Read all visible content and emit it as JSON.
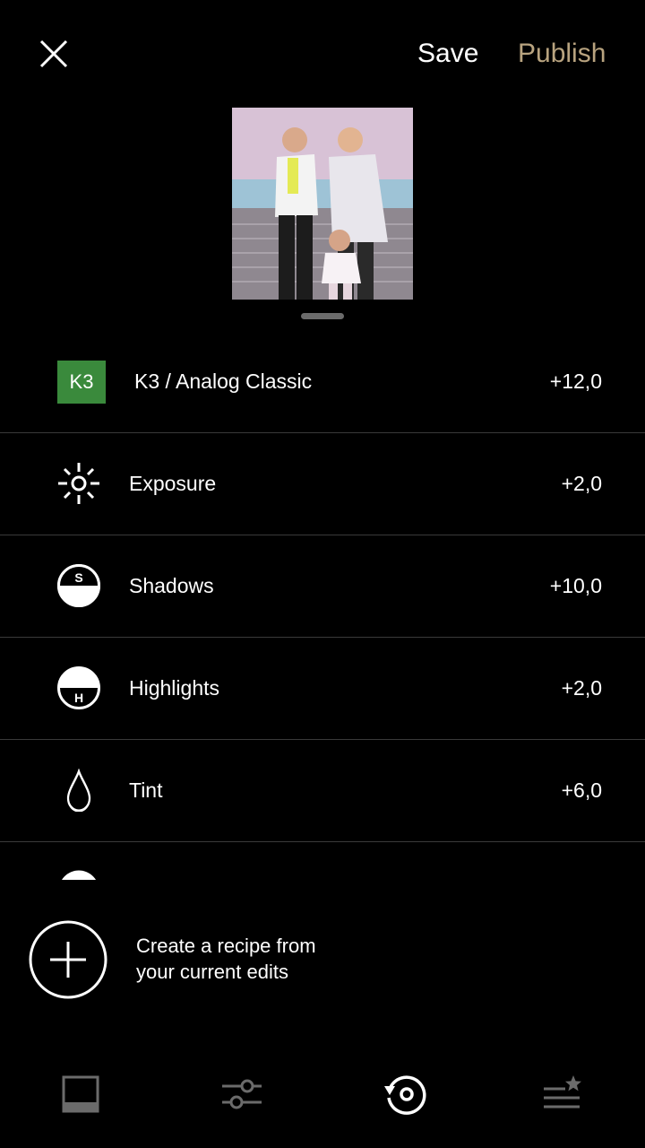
{
  "header": {
    "save_label": "Save",
    "publish_label": "Publish"
  },
  "colors": {
    "accent": "#b8a37f",
    "preset_badge": "#3a8a3c",
    "divider": "#3a3a3a",
    "inactive_icon": "#6b6b6b"
  },
  "preview": {
    "icon": "photo-thumbnail"
  },
  "edits": [
    {
      "icon": "preset-badge",
      "badge": "K3",
      "label": "K3 / Analog Classic",
      "value": "+12,0"
    },
    {
      "icon": "exposure-icon",
      "label": "Exposure",
      "value": "+2,0"
    },
    {
      "icon": "shadows-icon",
      "badge": "S",
      "label": "Shadows",
      "value": "+10,0"
    },
    {
      "icon": "highlights-icon",
      "badge": "H",
      "label": "Highlights",
      "value": "+2,0"
    },
    {
      "icon": "tint-icon",
      "label": "Tint",
      "value": "+6,0"
    }
  ],
  "recipe": {
    "line1": "Create a recipe from",
    "line2": "your current edits"
  },
  "bottom_nav": [
    {
      "icon": "presets-icon",
      "active": false
    },
    {
      "icon": "tools-icon",
      "active": false
    },
    {
      "icon": "history-icon",
      "active": true
    },
    {
      "icon": "recipes-icon",
      "active": false
    }
  ]
}
